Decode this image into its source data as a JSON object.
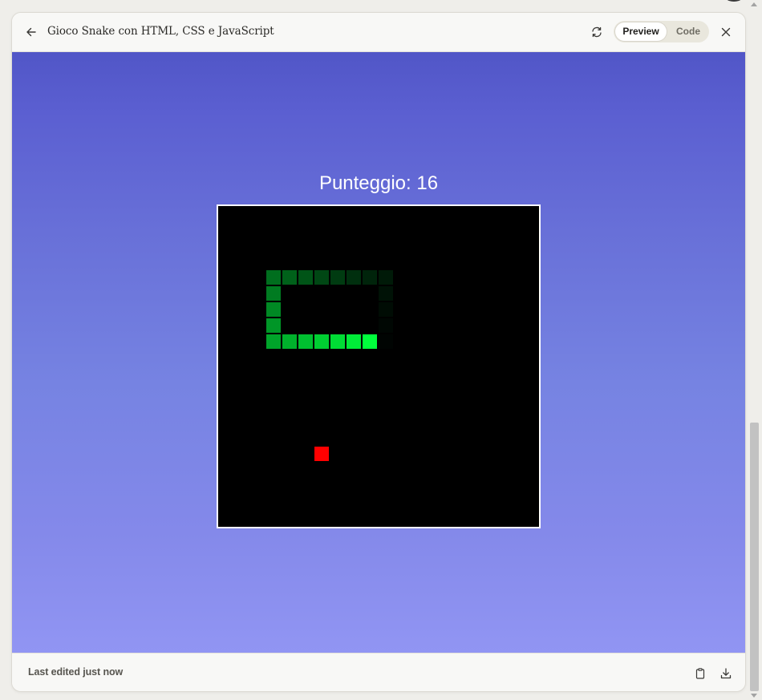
{
  "window": {
    "title": "Gioco Snake con HTML, CSS e JavaScript"
  },
  "header": {
    "back_icon": "arrow-left-icon",
    "refresh_icon": "refresh-icon",
    "close_icon": "close-icon",
    "view_toggle": {
      "preview_label": "Preview",
      "code_label": "Code",
      "selected": "Preview"
    }
  },
  "game": {
    "score_text": "Punteggio: 16",
    "grid_size": 20,
    "background_color": "#000000",
    "border_color": "#ffffff",
    "food": {
      "col": 6,
      "row": 15,
      "color": "#ff0000"
    },
    "snake": [
      {
        "col": 9,
        "row": 8,
        "color": "#00ff3c"
      },
      {
        "col": 8,
        "row": 8,
        "color": "#00ec38"
      },
      {
        "col": 7,
        "row": 8,
        "color": "#00dd35"
      },
      {
        "col": 6,
        "row": 8,
        "color": "#00cf32"
      },
      {
        "col": 5,
        "row": 8,
        "color": "#00c030"
      },
      {
        "col": 4,
        "row": 8,
        "color": "#00b22c"
      },
      {
        "col": 3,
        "row": 8,
        "color": "#00a42a"
      },
      {
        "col": 3,
        "row": 7,
        "color": "#009627"
      },
      {
        "col": 3,
        "row": 6,
        "color": "#008924"
      },
      {
        "col": 3,
        "row": 5,
        "color": "#007b21"
      },
      {
        "col": 3,
        "row": 4,
        "color": "#006e1e"
      },
      {
        "col": 4,
        "row": 4,
        "color": "#00611a"
      },
      {
        "col": 5,
        "row": 4,
        "color": "#005417"
      },
      {
        "col": 6,
        "row": 4,
        "color": "#004714"
      },
      {
        "col": 7,
        "row": 4,
        "color": "#003b11"
      },
      {
        "col": 8,
        "row": 4,
        "color": "#002f0e"
      },
      {
        "col": 9,
        "row": 4,
        "color": "#00240b"
      },
      {
        "col": 10,
        "row": 4,
        "color": "#001a08"
      },
      {
        "col": 10,
        "row": 5,
        "color": "#001206"
      },
      {
        "col": 10,
        "row": 6,
        "color": "#000c04"
      },
      {
        "col": 10,
        "row": 7,
        "color": "#000703"
      },
      {
        "col": 10,
        "row": 8,
        "color": "#000402"
      }
    ]
  },
  "footer": {
    "status_text": "Last edited just now",
    "copy_icon": "clipboard-icon",
    "download_icon": "download-icon"
  },
  "colors": {
    "gradient_top": "#5156c7",
    "gradient_bottom": "#9195f3",
    "panel_bg": "#f8f8f6"
  }
}
